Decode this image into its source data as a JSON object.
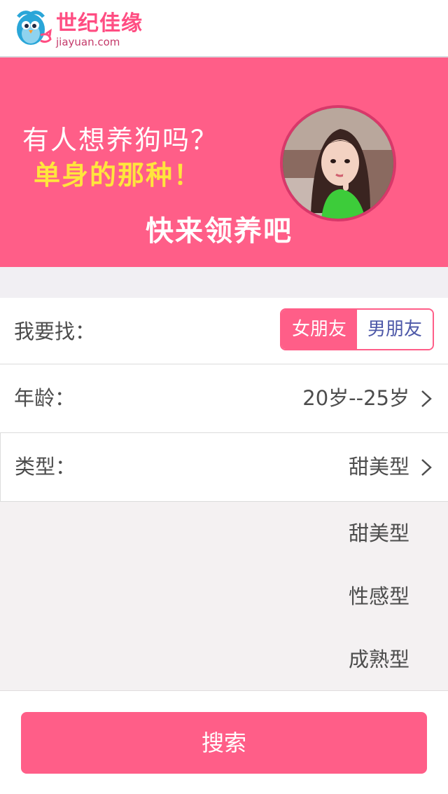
{
  "header": {
    "logo_text": "世纪佳缘",
    "logo_domain": "jiayuan.com",
    "logo_icon": "bird-mascot-icon"
  },
  "banner": {
    "line1": "有人想养狗吗？",
    "line2": "单身的那种！",
    "line3": "快来领养吧",
    "avatar": "profile-photo"
  },
  "form": {
    "find": {
      "label": "我要找：",
      "options": [
        "女朋友",
        "男朋友"
      ],
      "selected": "女朋友"
    },
    "age": {
      "label": "年龄：",
      "value": "20岁--25岁"
    },
    "type": {
      "label": "类型：",
      "value": "甜美型",
      "options": [
        "甜美型",
        "性感型",
        "成熟型"
      ]
    }
  },
  "search": {
    "label": "搜索"
  },
  "colors": {
    "accent": "#ff5e88",
    "highlight_text": "#ffe53d",
    "male_text": "#4d58a8",
    "dropdown_bg": "#f4f1f2"
  }
}
